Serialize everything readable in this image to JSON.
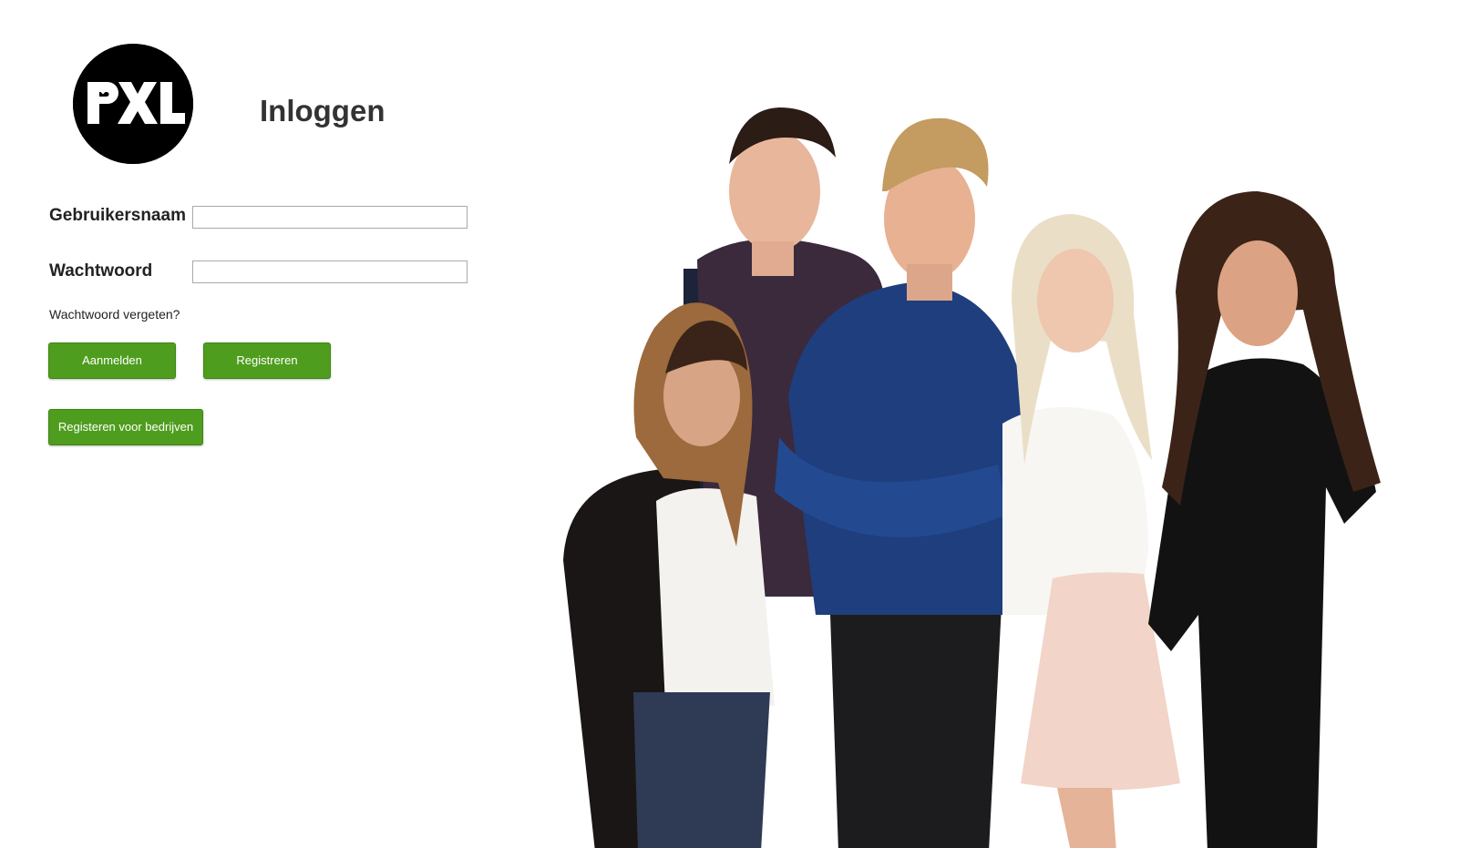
{
  "logo": {
    "text": "PXL",
    "icon": "heart-icon",
    "color": "#000000"
  },
  "page": {
    "title": "Inloggen"
  },
  "form": {
    "username_label": "Gebruikersnaam",
    "username_value": "",
    "password_label": "Wachtwoord",
    "password_value": "",
    "forgot_password": "Wachtwoord vergeten?",
    "login_button": "Aanmelden",
    "register_button": "Registreren",
    "company_register_button": "Registeren voor bedrijven"
  },
  "colors": {
    "button_green": "#4f9d1e",
    "text": "#333333"
  }
}
